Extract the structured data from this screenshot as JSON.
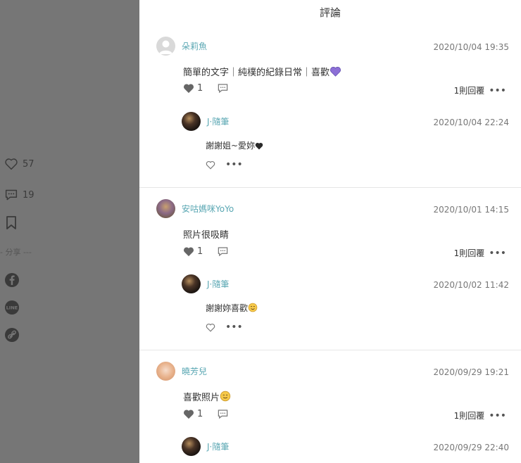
{
  "sidebar": {
    "like_count": "57",
    "comment_count": "19",
    "share_label": "- 分享 ---"
  },
  "panel": {
    "title": "評論"
  },
  "comments": [
    {
      "user": "朵莉魚",
      "time": "2020/10/04 19:35",
      "text": "簡單的文字｜純樸的紀錄日常｜喜歡",
      "likes": "1",
      "reply_count": "1則回覆",
      "reply": {
        "user": "J·隨筆",
        "time": "2020/10/04 22:24",
        "text": "謝謝姐~愛妳"
      }
    },
    {
      "user": "安咕媽咪YoYo",
      "time": "2020/10/01 14:15",
      "text": "照片很吸睛",
      "likes": "1",
      "reply_count": "1則回覆",
      "reply": {
        "user": "J·隨筆",
        "time": "2020/10/02 11:42",
        "text": "謝謝妳喜歡"
      }
    },
    {
      "user": "曉芳兒",
      "time": "2020/09/29 19:21",
      "text": "喜歡照片",
      "likes": "1",
      "reply_count": "1則回覆",
      "reply": {
        "user": "J·隨筆",
        "time": "2020/09/29 22:40",
        "text": ""
      }
    }
  ],
  "colors": {
    "username": "#5aa7b3",
    "rail": "#767676",
    "heart_purple": "#8c6fd6"
  }
}
